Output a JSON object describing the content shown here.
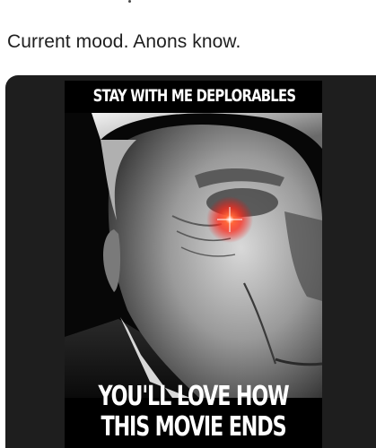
{
  "post": {
    "text": "Current mood. Anons know."
  },
  "meme": {
    "top_caption": "STAY WITH ME DEPLORABLES",
    "bottom_caption_line1": "YOU'LL LOVE HOW",
    "bottom_caption_line2": "THIS MOVIE ENDS",
    "colors": {
      "card_background": "#1e1e1e",
      "eye_glow": "#ff2a1a",
      "caption_text": "#ffffff"
    }
  }
}
